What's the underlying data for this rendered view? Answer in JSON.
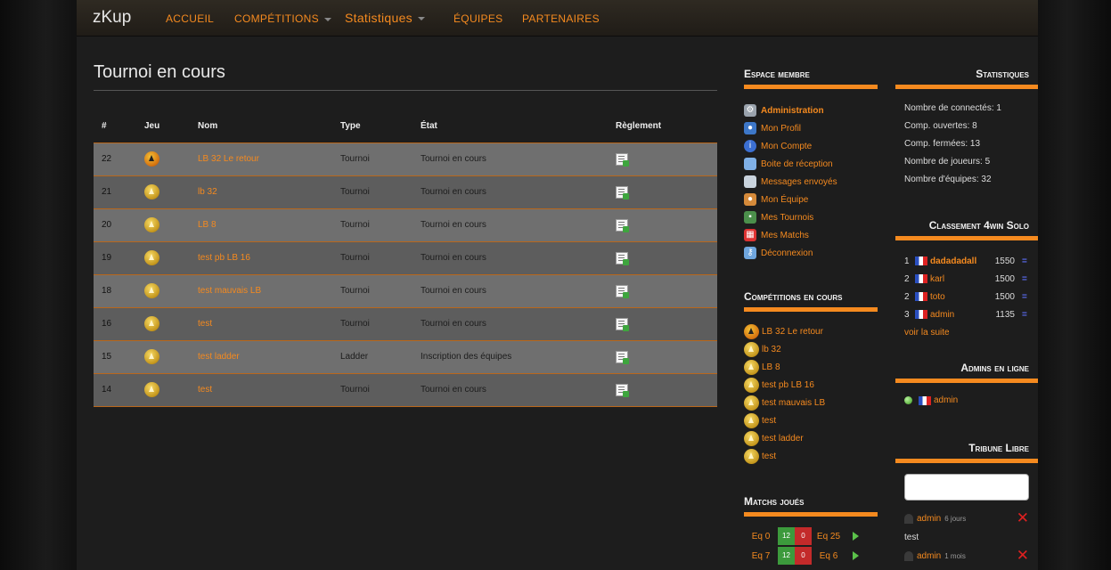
{
  "nav": {
    "brand": "zKup",
    "items": [
      {
        "label": "Accueil"
      },
      {
        "label": "Compétitions"
      },
      {
        "label": "Statistiques"
      },
      {
        "label": "Équipes"
      },
      {
        "label": "Partenaires"
      }
    ]
  },
  "main": {
    "title": "Tournoi en cours",
    "columns": [
      "#",
      "Jeu",
      "Nom",
      "Type",
      "État",
      "Règlement"
    ],
    "rows": [
      {
        "id": "22",
        "name": "LB 32 Le retour",
        "type": "Tournoi",
        "state": "Tournoi en cours",
        "game_icon": "special-medal-icon"
      },
      {
        "id": "21",
        "name": "lb 32",
        "type": "Tournoi",
        "state": "Tournoi en cours",
        "game_icon": "medal-icon"
      },
      {
        "id": "20",
        "name": "LB 8",
        "type": "Tournoi",
        "state": "Tournoi en cours",
        "game_icon": "medal-icon"
      },
      {
        "id": "19",
        "name": "test pb LB 16",
        "type": "Tournoi",
        "state": "Tournoi en cours",
        "game_icon": "medal-icon"
      },
      {
        "id": "18",
        "name": "test mauvais LB",
        "type": "Tournoi",
        "state": "Tournoi en cours",
        "game_icon": "medal-icon"
      },
      {
        "id": "16",
        "name": "test",
        "type": "Tournoi",
        "state": "Tournoi en cours",
        "game_icon": "medal-icon"
      },
      {
        "id": "15",
        "name": "test ladder",
        "type": "Ladder",
        "state": "Inscription des équipes",
        "game_icon": "medal-icon"
      },
      {
        "id": "14",
        "name": "test",
        "type": "Tournoi",
        "state": "Tournoi en cours",
        "game_icon": "medal-icon"
      }
    ]
  },
  "member": {
    "title": "Espace membre",
    "items": [
      {
        "label": "Administration",
        "icon": "gear-icon"
      },
      {
        "label": "Mon Profil",
        "icon": "user-icon"
      },
      {
        "label": "Mon Compte",
        "icon": "info-icon"
      },
      {
        "label": "Boite de réception",
        "icon": "chat-bubble-icon"
      },
      {
        "label": "Messages envoyés",
        "icon": "chat-bubble-icon"
      },
      {
        "label": "Mon Équipe",
        "icon": "users-icon"
      },
      {
        "label": "Mes Tournois",
        "icon": "tree-icon"
      },
      {
        "label": "Mes Matchs",
        "icon": "calendar-icon"
      },
      {
        "label": "Déconnexion",
        "icon": "key-icon"
      }
    ]
  },
  "competitions": {
    "title": "Compétitions en cours",
    "items": [
      "LB 32 Le retour",
      "lb 32",
      "LB 8",
      "test pb LB 16",
      "test mauvais LB",
      "test",
      "test ladder",
      "test"
    ]
  },
  "matches": {
    "title": "Matchs joués",
    "rows": [
      {
        "team_a": "Eq 0",
        "score_a": "12",
        "score_b": "0",
        "team_b": "Eq 25"
      },
      {
        "team_a": "Eq 7",
        "score_a": "12",
        "score_b": "0",
        "team_b": "Eq 6"
      }
    ]
  },
  "stats": {
    "title": "Statistiques",
    "items": [
      "Nombre de connectés: 1",
      "Comp. ouvertes: 8",
      "Comp. fermées: 13",
      "Nombre de joueurs: 5",
      "Nombre d'équipes: 32"
    ]
  },
  "ranking": {
    "title": "Classement 4win Solo",
    "rows": [
      {
        "pos": "1",
        "name": "dadadadall",
        "score": "1550",
        "trend": "="
      },
      {
        "pos": "2",
        "name": "karl",
        "score": "1500",
        "trend": "="
      },
      {
        "pos": "2",
        "name": "toto",
        "score": "1500",
        "trend": "="
      },
      {
        "pos": "3",
        "name": "admin",
        "score": "1135",
        "trend": "="
      }
    ],
    "see_more": "voir la suite"
  },
  "admins": {
    "title": "Admins en ligne",
    "name": "admin"
  },
  "tribune": {
    "title": "Tribune Libre",
    "messages": [
      {
        "author": "admin",
        "when": "6 jours",
        "text": "test"
      },
      {
        "author": "admin",
        "when": "1 mois",
        "text": ""
      }
    ]
  }
}
